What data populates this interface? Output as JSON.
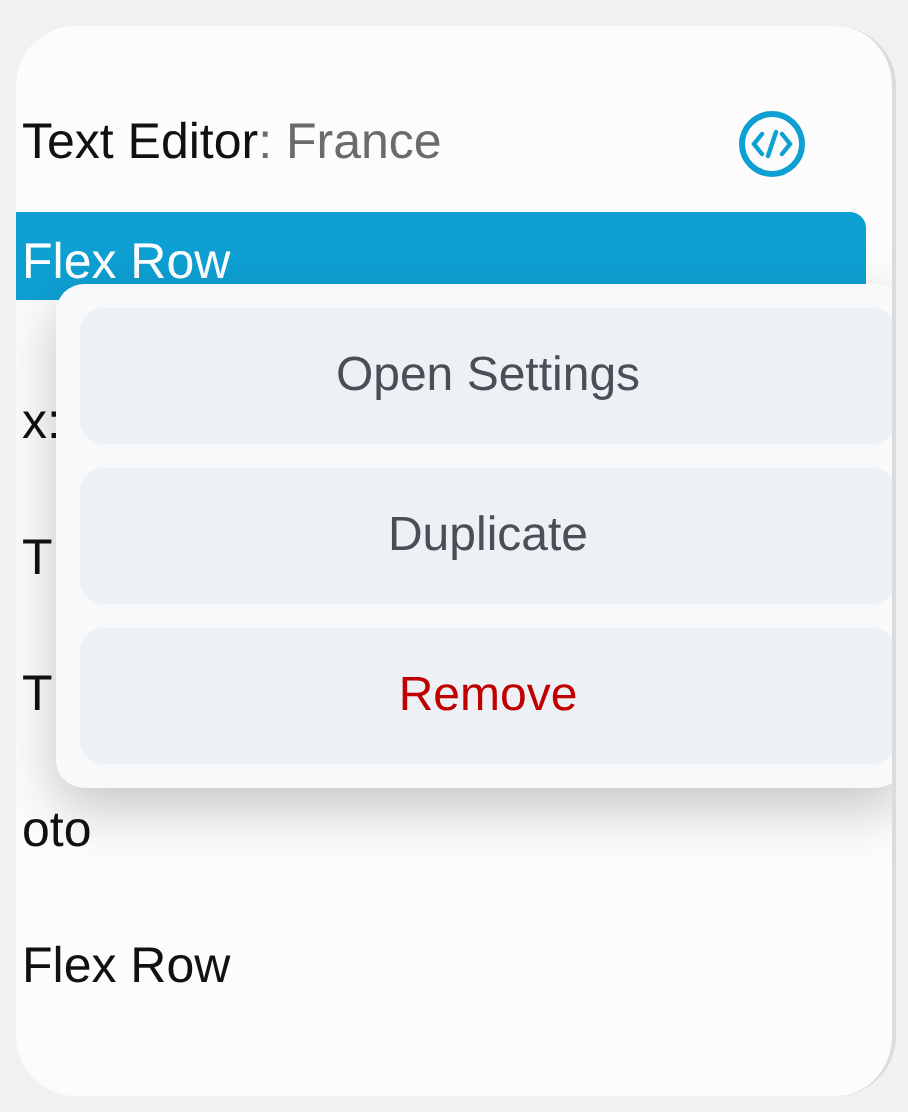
{
  "list": {
    "rows": [
      {
        "label": "Text Editor",
        "value": ": France",
        "kind": "editor",
        "selected": false
      },
      {
        "label": "Flex Row",
        "selected": true
      },
      {
        "label": "x:",
        "selected": false
      },
      {
        "label": "T",
        "selected": false
      },
      {
        "label": "T",
        "selected": false
      },
      {
        "label": "oto",
        "selected": false
      },
      {
        "label": "Flex Row",
        "selected": false
      }
    ]
  },
  "context_menu": {
    "items": [
      {
        "label": "Open Settings",
        "kind": "normal"
      },
      {
        "label": "Duplicate",
        "kind": "normal"
      },
      {
        "label": "Remove",
        "kind": "destructive"
      }
    ]
  }
}
